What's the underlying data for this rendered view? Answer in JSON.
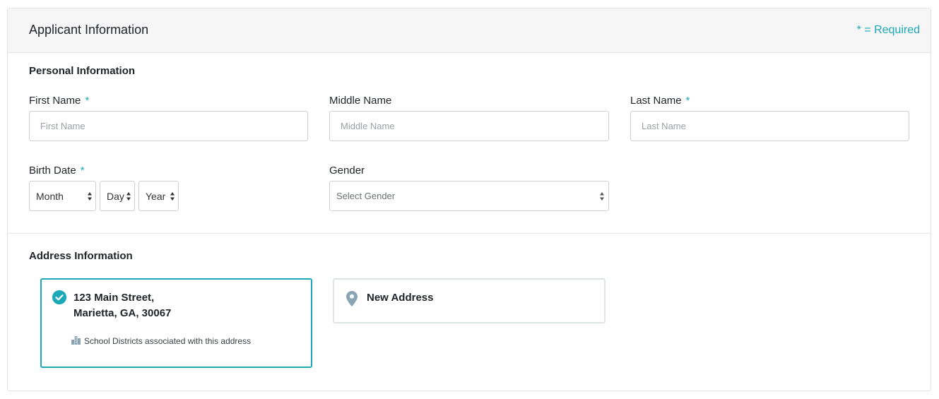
{
  "header": {
    "title": "Applicant Information",
    "required_note": "* = Required"
  },
  "personal": {
    "section_title": "Personal Information",
    "first_name": {
      "label": "First Name",
      "required": "*",
      "placeholder": "First Name"
    },
    "middle_name": {
      "label": "Middle Name",
      "placeholder": "Middle Name"
    },
    "last_name": {
      "label": "Last Name",
      "required": "*",
      "placeholder": "Last Name"
    },
    "birth_date": {
      "label": "Birth Date",
      "required": "*",
      "month": "Month",
      "day": "Day",
      "year": "Year"
    },
    "gender": {
      "label": "Gender",
      "selected": "Select Gender"
    }
  },
  "address": {
    "section_title": "Address Information",
    "selected_address": {
      "line1": "123 Main Street,",
      "line2": "Marietta, GA, 30067",
      "districts_text": "School Districts associated with this address"
    },
    "new_address_label": "New Address"
  },
  "colors": {
    "accent": "#1ba8b8",
    "header_bg": "#f6f6f6",
    "border": "#cfcfcf"
  },
  "icons": {
    "check": "check-circle-icon",
    "district": "building-icon",
    "pin": "map-pin-icon",
    "select": "select-arrows-icon"
  }
}
